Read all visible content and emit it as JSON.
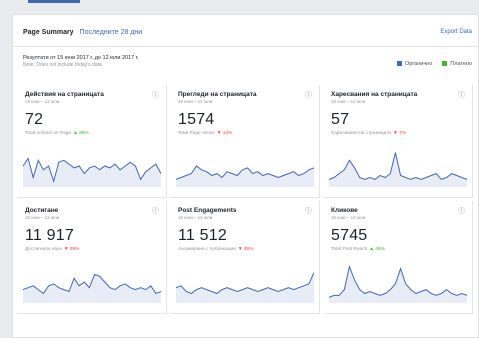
{
  "header": {
    "title": "Page Summary",
    "period": "Последните 28 дни",
    "export": "Export Data"
  },
  "range": {
    "text": "Резултати от 15 юни 2017 г. до 12 юли 2017 г.",
    "note": "Note: Does not include today's data"
  },
  "legend": [
    {
      "label": "Органично",
      "color": "#4267b2"
    },
    {
      "label": "Платено",
      "color": "#42b72a"
    }
  ],
  "cards": [
    {
      "title": "Действия на страницата",
      "date": "15 юни – 12 юли",
      "value": "72",
      "sub": "Total Actions on Page",
      "change": "▲ 86%",
      "trend": "up",
      "series": [
        22,
        14,
        34,
        16,
        26,
        22,
        38,
        18,
        16,
        20,
        24,
        22,
        30,
        24,
        22,
        26,
        22,
        24,
        20,
        26,
        22,
        18,
        22,
        36,
        28,
        24,
        20,
        30
      ]
    },
    {
      "title": "Прегледи на страницата",
      "date": "15 юни – 12 юли",
      "value": "1574",
      "sub": "Total Page Views",
      "change": "▼ 14%",
      "trend": "down",
      "series": [
        36,
        34,
        32,
        30,
        22,
        26,
        28,
        32,
        30,
        34,
        28,
        30,
        32,
        26,
        24,
        30,
        28,
        32,
        30,
        32,
        34,
        32,
        30,
        28,
        32,
        30,
        26,
        24
      ]
    },
    {
      "title": "Харесвания на страницата",
      "date": "15 юни – 12 юли",
      "value": "57",
      "sub": "Харесвания на страницата",
      "change": "▼ 7%",
      "trend": "down",
      "series": [
        36,
        34,
        30,
        26,
        16,
        24,
        34,
        36,
        34,
        36,
        32,
        34,
        30,
        8,
        32,
        34,
        36,
        34,
        36,
        34,
        32,
        30,
        36,
        34,
        30,
        32,
        34,
        36
      ]
    },
    {
      "title": "Достигане",
      "date": "15 юни – 12 юли",
      "value": "11 917",
      "sub": "Достигнати хора",
      "change": "▼ 39%",
      "trend": "down",
      "series": [
        30,
        28,
        26,
        30,
        34,
        26,
        24,
        28,
        30,
        32,
        18,
        26,
        22,
        28,
        14,
        16,
        22,
        28,
        30,
        26,
        24,
        28,
        30,
        28,
        30,
        26,
        34,
        32
      ]
    },
    {
      "title": "Post Engagements",
      "date": "15 юни – 12 юли",
      "value": "11 512",
      "sub": "Ангажиране с публикации",
      "change": "▼ 46%",
      "trend": "down",
      "series": [
        28,
        26,
        32,
        34,
        30,
        28,
        30,
        32,
        34,
        30,
        28,
        30,
        32,
        30,
        28,
        30,
        32,
        30,
        28,
        30,
        32,
        30,
        28,
        30,
        28,
        26,
        24,
        12
      ]
    },
    {
      "title": "Кликове",
      "date": "15 юни – 12 юли",
      "value": "5745",
      "sub": "Total Post Reach",
      "change": "▲ 45%",
      "trend": "up",
      "series": [
        38,
        36,
        36,
        30,
        6,
        20,
        30,
        34,
        32,
        34,
        36,
        34,
        30,
        24,
        8,
        24,
        30,
        34,
        32,
        30,
        34,
        36,
        34,
        30,
        34,
        36,
        34,
        36
      ]
    }
  ]
}
